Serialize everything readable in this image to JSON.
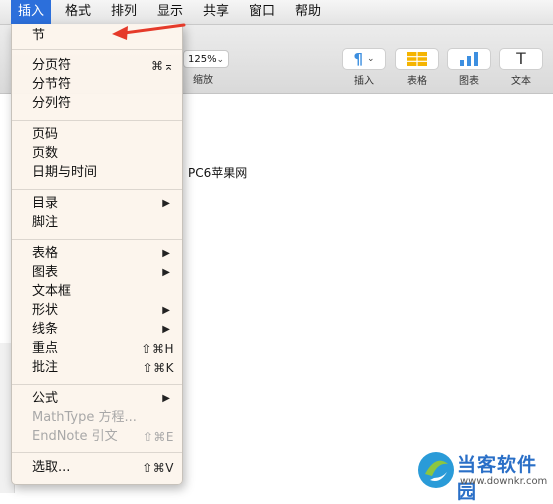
{
  "menubar": {
    "items": [
      {
        "label": "插入",
        "active": true
      },
      {
        "label": "格式"
      },
      {
        "label": "排列"
      },
      {
        "label": "显示"
      },
      {
        "label": "共享"
      },
      {
        "label": "窗口"
      },
      {
        "label": "帮助"
      }
    ]
  },
  "toolbar": {
    "zoom_value": "125%",
    "zoom_label": "缩放",
    "buttons": [
      {
        "label": "插入",
        "icon": "paragraph-icon"
      },
      {
        "label": "表格",
        "icon": "table-icon"
      },
      {
        "label": "图表",
        "icon": "chart-icon"
      },
      {
        "label": "文本",
        "icon": "text-icon"
      }
    ]
  },
  "document": {
    "text": "PC6苹果网"
  },
  "dropdown": {
    "items": [
      {
        "label": "节"
      },
      {
        "label": "分页符",
        "shortcut": "⌘⌅"
      },
      {
        "label": "分节符"
      },
      {
        "label": "分列符"
      },
      {
        "label": "页码"
      },
      {
        "label": "页数"
      },
      {
        "label": "日期与时间"
      },
      {
        "label": "目录",
        "submenu": true
      },
      {
        "label": "脚注"
      },
      {
        "label": "表格",
        "submenu": true
      },
      {
        "label": "图表",
        "submenu": true
      },
      {
        "label": "文本框"
      },
      {
        "label": "形状",
        "submenu": true
      },
      {
        "label": "线条",
        "submenu": true
      },
      {
        "label": "重点",
        "shortcut": "⇧⌘H"
      },
      {
        "label": "批注",
        "shortcut": "⇧⌘K"
      },
      {
        "label": "公式",
        "submenu": true
      },
      {
        "label": "MathType 方程...",
        "disabled": true
      },
      {
        "label": "EndNote 引文",
        "shortcut": "⇧⌘E",
        "disabled": true
      },
      {
        "label": "选取...",
        "shortcut": "⇧⌘V"
      }
    ]
  },
  "watermark": {
    "name": "当客软件园",
    "url": "www.downkr.com"
  },
  "colors": {
    "menu_highlight": "#2c6fdb",
    "annotation_arrow": "#e53a2a",
    "toolbar_icon": "#f5b400",
    "chart_icon": "#3d8fe0"
  }
}
